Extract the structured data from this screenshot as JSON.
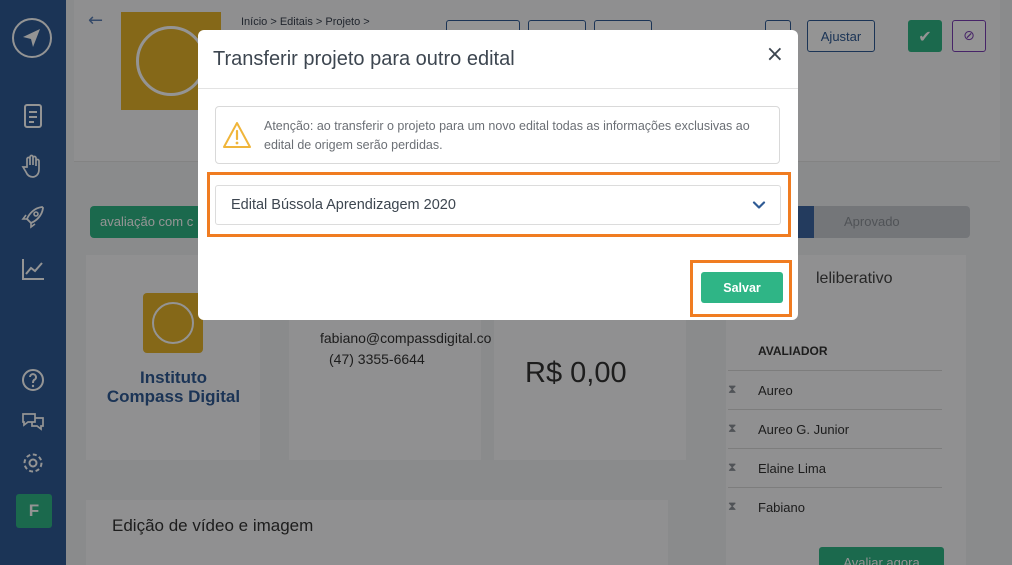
{
  "sidebar": {
    "icons": [
      "compass-logo-icon",
      "document-icon",
      "hand-heart-icon",
      "rocket-icon",
      "chart-trend-icon",
      "help-circle-icon",
      "chat-icon",
      "gear-icon"
    ],
    "avatar_letter": "F"
  },
  "header": {
    "breadcrumb": "Início  >  Editais  >  Projeto  >",
    "ajustar_label": "Ajustar"
  },
  "status": {
    "left_label": "avaliação com c",
    "right_label": "Aprovado"
  },
  "institution": {
    "name": "Instituto Compass Digital",
    "email": "fabiano@compassdigital.co",
    "phone": "(47) 3355-6644"
  },
  "amount": "R$ 0,00",
  "deliberative": {
    "title": "leliberativo",
    "column_header": "AVALIADOR",
    "evaluators": [
      "Aureo",
      "Aureo G. Junior",
      "Elaine Lima",
      "Fabiano"
    ],
    "evaluate_label": "Avaliar agora"
  },
  "section_title": "Edição de vídeo e imagem",
  "modal": {
    "title": "Transferir projeto para outro edital",
    "close_glyph": "×",
    "alert_text": "Atenção: ao transferir o projeto para um novo edital todas as informações exclusivas ao edital de origem serão perdidas.",
    "select_value": "Edital Bússola Aprendizagem 2020",
    "save_label": "Salvar"
  },
  "colors": {
    "sidebar": "#2f5b95",
    "accent_green": "#2fb586",
    "highlight_orange": "#f07c21",
    "brand_yellow": "#e6b42a"
  }
}
